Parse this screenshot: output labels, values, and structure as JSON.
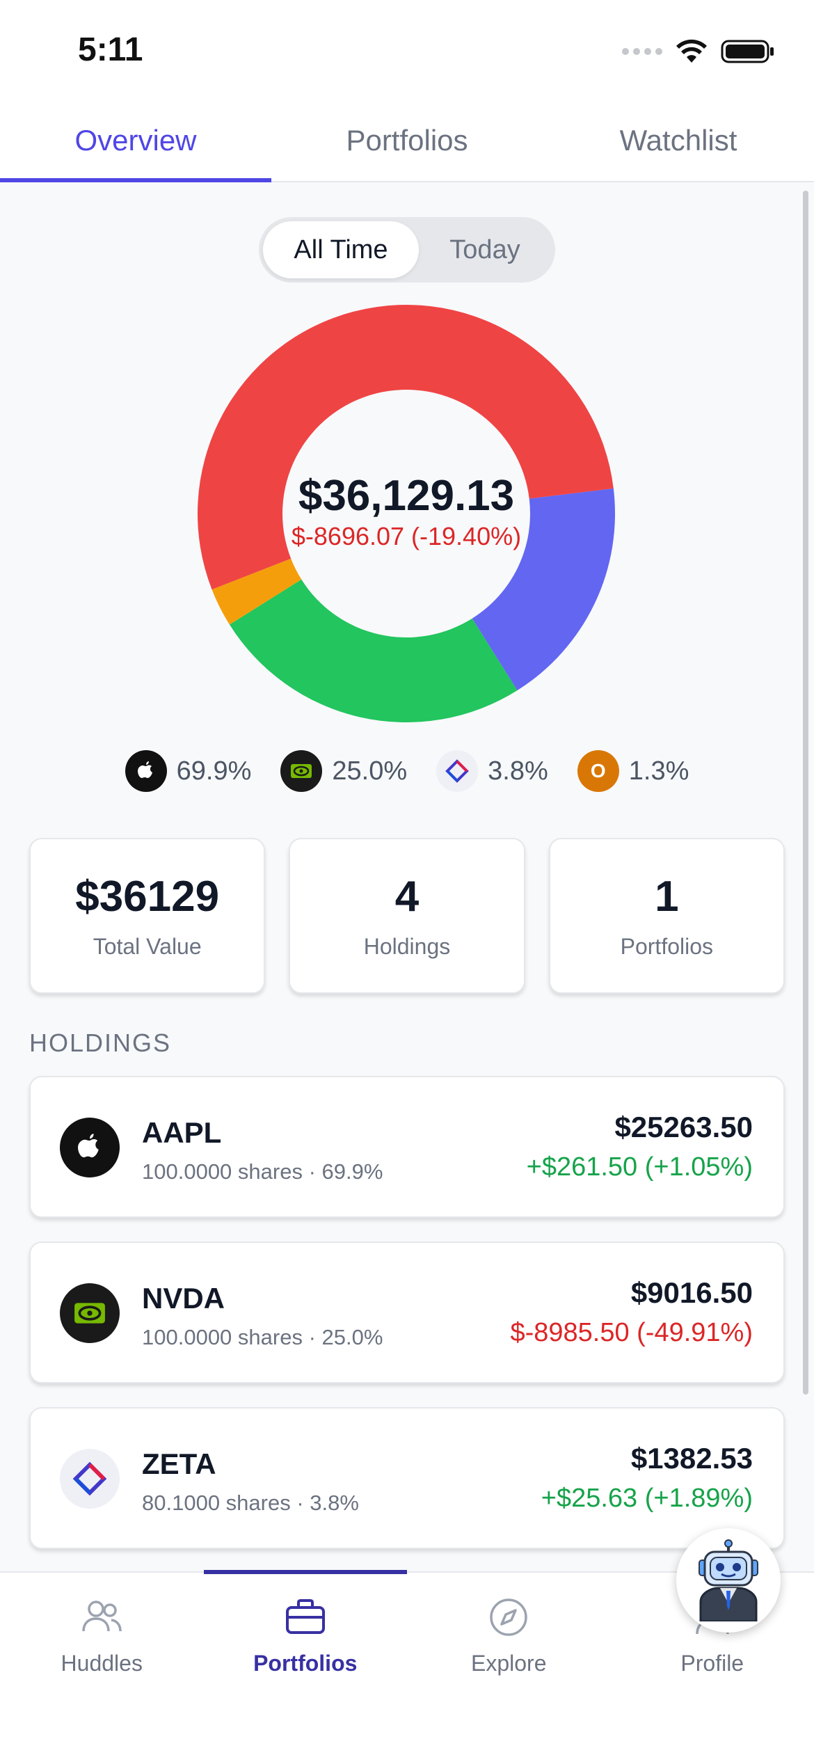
{
  "status": {
    "time": "5:11"
  },
  "tabs": [
    {
      "label": "Overview"
    },
    {
      "label": "Portfolios"
    },
    {
      "label": "Watchlist"
    }
  ],
  "range_toggle": {
    "options": [
      "All Time",
      "Today"
    ],
    "selected": "All Time"
  },
  "allocation": {
    "total_value": "$36,129.13",
    "change": "$-8696.07 (-19.40%)",
    "legend": [
      {
        "ticker": "AAPL",
        "percent": "69.9%",
        "color": "#ef4444"
      },
      {
        "ticker": "NVDA",
        "percent": "25.0%",
        "color": "#22c55e"
      },
      {
        "ticker": "ZETA",
        "percent": "3.8%",
        "color": "#6366f1"
      },
      {
        "ticker": "O",
        "logo_letter": "O",
        "percent": "1.3%",
        "color": "#f59e0b"
      }
    ]
  },
  "chart_data": {
    "type": "pie",
    "categories": [
      "AAPL",
      "NVDA",
      "ZETA",
      "O"
    ],
    "values": [
      69.9,
      25.0,
      3.8,
      1.3
    ],
    "colors": [
      "#ef4444",
      "#6366f1",
      "#22c55e",
      "#f59e0b"
    ]
  },
  "stats": [
    {
      "value": "$36129",
      "label": "Total Value"
    },
    {
      "value": "4",
      "label": "Holdings"
    },
    {
      "value": "1",
      "label": "Portfolios"
    }
  ],
  "holdings_title": "HOLDINGS",
  "holdings": [
    {
      "ticker": "AAPL",
      "meta": "100.0000 shares · 69.9%",
      "price": "$25263.50",
      "change": "+$261.50 (+1.05%)",
      "direction": "up"
    },
    {
      "ticker": "NVDA",
      "meta": "100.0000 shares · 25.0%",
      "price": "$9016.50",
      "change": "$-8985.50 (-49.91%)",
      "direction": "down"
    },
    {
      "ticker": "ZETA",
      "meta": "80.1000 shares · 3.8%",
      "price": "$1382.53",
      "change": "+$25.63 (+1.89%)",
      "direction": "up"
    }
  ],
  "bottom_nav": [
    {
      "label": "Huddles",
      "icon": "people-icon"
    },
    {
      "label": "Portfolios",
      "icon": "briefcase-icon"
    },
    {
      "label": "Explore",
      "icon": "compass-icon"
    },
    {
      "label": "Profile",
      "icon": "person-icon"
    }
  ],
  "colors": {
    "accent": "#4f46e5",
    "positive": "#16a34a",
    "negative": "#dc2626"
  }
}
